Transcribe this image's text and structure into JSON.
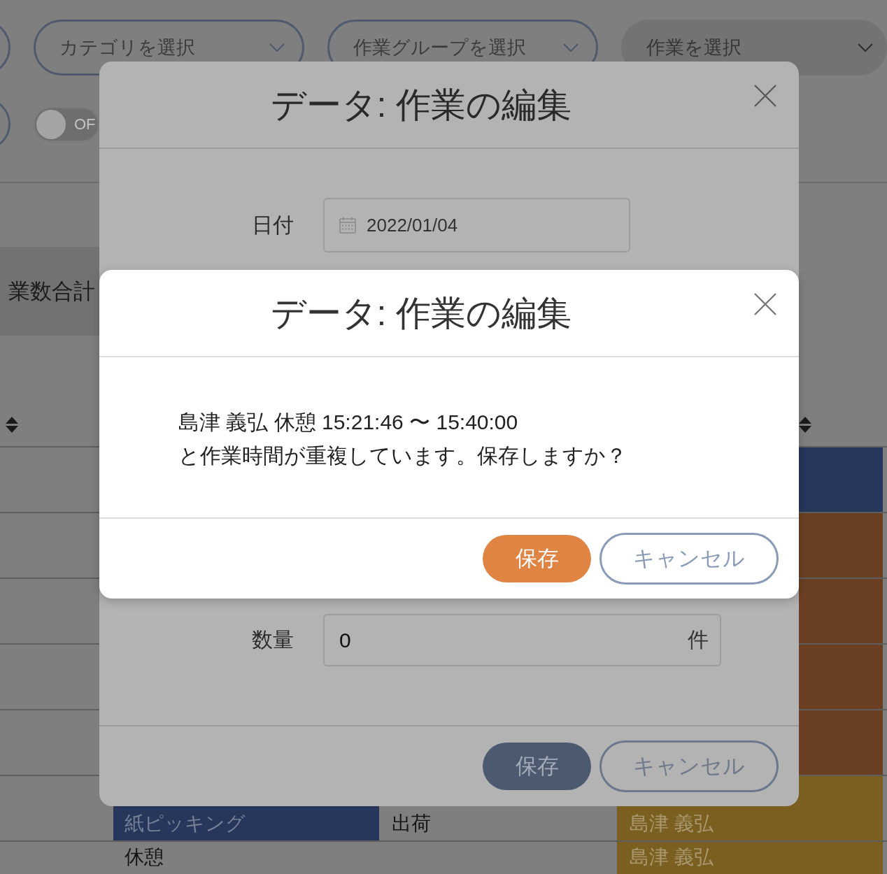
{
  "toolbar": {
    "row_1": [
      {
        "kind": "cut_select"
      },
      {
        "kind": "select",
        "placeholder": "カテゴリを選択",
        "disabled": false
      },
      {
        "kind": "select",
        "placeholder": "作業グループを選択",
        "disabled": false
      },
      {
        "kind": "select",
        "placeholder": "作業を選択",
        "disabled": true
      }
    ],
    "row_2": [
      {
        "kind": "cut_select"
      },
      {
        "kind": "toggle",
        "label": "OF",
        "on": false
      }
    ]
  },
  "summary": {
    "label": "業数合計"
  },
  "table": {
    "rows": [
      {
        "column_3": {
          "color": "#26375b"
        }
      },
      {
        "column_3": {
          "color": "#6b3f22"
        }
      },
      {
        "column_3": {
          "color": "#6b3f22"
        }
      },
      {
        "column_3": {
          "color": "#6b3f22"
        }
      },
      {
        "column_3": {
          "color": "#6b3f22"
        }
      },
      {
        "column_1": {
          "text": "紙ピッキング",
          "color": "#26375b"
        },
        "column_2": {
          "text": "出荷"
        },
        "column_3": {
          "text": "島津 義弘",
          "color": "#7a5f20"
        }
      },
      {
        "column_1": {
          "text": "休憩"
        },
        "column_3": {
          "text": "島津 義弘",
          "color": "#7a5f20"
        }
      }
    ]
  },
  "dialogs": [
    {
      "dimmed": true,
      "title": "データ: 作業の編集",
      "fields": [
        {
          "kind": "date",
          "label": "日付",
          "value": "2022/01/04"
        },
        {
          "kind": "quantity",
          "label": "数量",
          "value": "0",
          "unit": "件"
        }
      ],
      "buttons": [
        {
          "kind": "primary",
          "label": "保存"
        },
        {
          "kind": "outline",
          "label": "キャンセル"
        }
      ]
    },
    {
      "dimmed": false,
      "title": "データ: 作業の編集",
      "message": [
        "島津 義弘 休憩 15:21:46 〜 15:40:00",
        "と作業時間が重複しています。保存しますか？"
      ],
      "buttons": [
        {
          "kind": "warning",
          "label": "保存"
        },
        {
          "kind": "outline",
          "label": "キャンセル"
        }
      ]
    }
  ]
}
